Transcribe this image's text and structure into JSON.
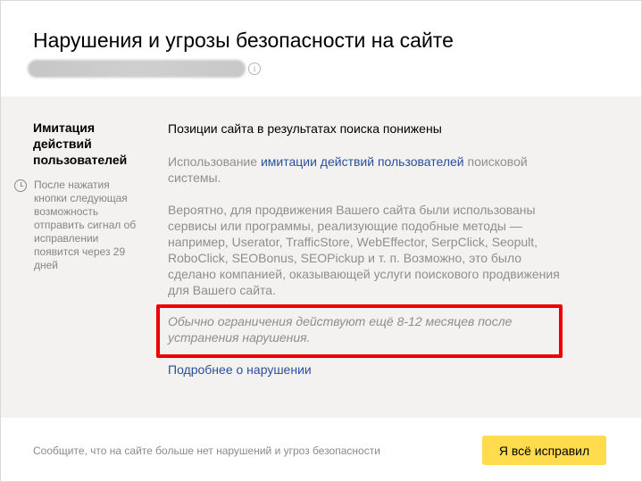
{
  "header": {
    "title": "Нарушения и угрозы безопасности на сайте",
    "info_icon": "info-icon"
  },
  "sidebar": {
    "violation_title": "Имитация действий пользователей",
    "note_icon": "clock-icon",
    "note": "После нажатия кнопки следующая возможность отправить сигнал об исправлении появится через 29 дней"
  },
  "main": {
    "heading": "Позиции сайта в результатах поиска понижены",
    "p1_before": "Использование ",
    "p1_link": "имитации действий пользователей",
    "p1_after": " поисковой системы.",
    "p2": "Вероятно, для продвижения Вашего сайта были использованы сервисы или программы, реализующие подобные методы — например, Userator, TrafficStore, WebEffector, SerpClick, Seopult, RoboClick, SEOBonus, SEOPickup и т. п. Возможно, это было сделано компанией, оказывающей услуги поискового продвижения для Вашего сайта.",
    "p3": "Обычно ограничения действуют ещё 8-12 месяцев после устранения нарушения.",
    "more_link": "Подробнее о нарушении"
  },
  "footer": {
    "text": "Сообщите, что на сайте больше нет нарушений и угроз безопасности",
    "button_label": "Я всё исправил",
    "button_color": "#ffdb4d"
  },
  "colors": {
    "highlight_border": "#ee0000",
    "link": "#2a4f9c",
    "panel_background": "#f3f2f0"
  }
}
